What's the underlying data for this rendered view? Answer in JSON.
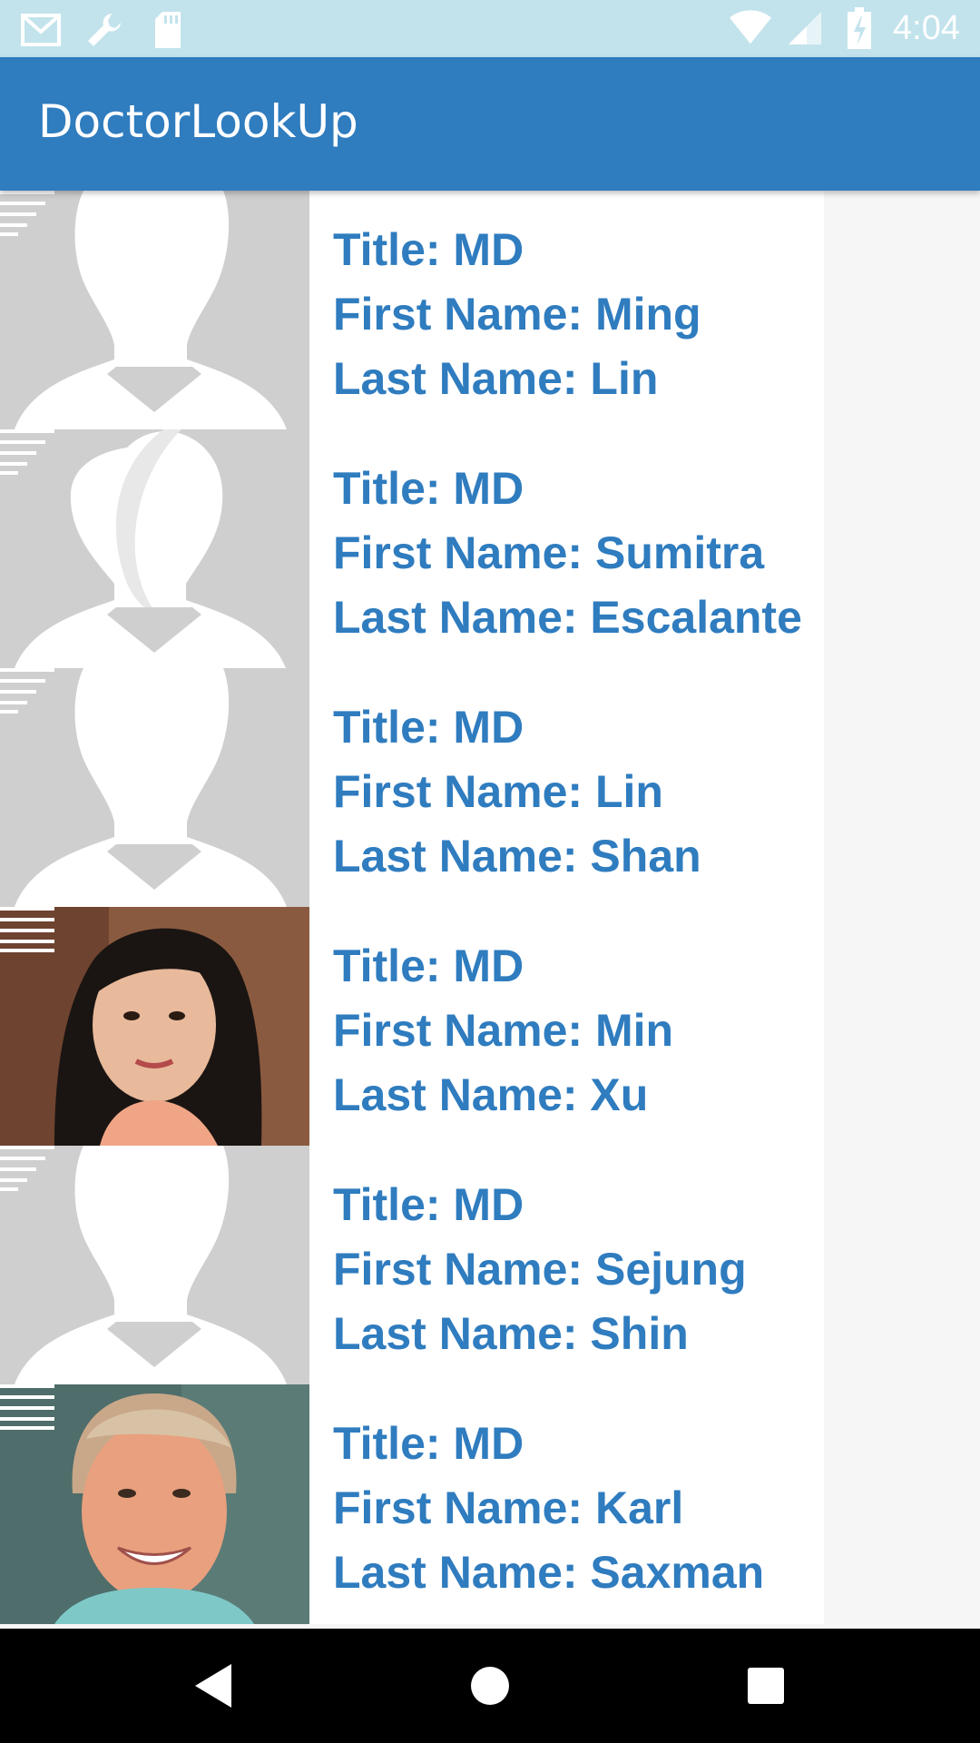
{
  "status_bar": {
    "time": "4:04",
    "icons": [
      "gmail-icon",
      "wrench-icon",
      "sd-card-icon",
      "wifi-icon",
      "signal-icon",
      "battery-charging-icon"
    ]
  },
  "app_bar": {
    "title": "DoctorLookUp"
  },
  "doctors": [
    {
      "title": "Title: MD",
      "first": "First Name: Ming",
      "last": "Last Name: Lin",
      "photo": "male-placeholder-avatar"
    },
    {
      "title": "Title: MD",
      "first": "First Name: Sumitra",
      "last": "Last Name: Escalante",
      "photo": "female-placeholder-avatar"
    },
    {
      "title": "Title: MD",
      "first": "First Name: Lin",
      "last": "Last Name: Shan",
      "photo": "male-placeholder-avatar"
    },
    {
      "title": "Title: MD",
      "first": "First Name: Min",
      "last": "Last Name: Xu",
      "photo": "portrait-photo"
    },
    {
      "title": "Title: MD",
      "first": "First Name: Sejung",
      "last": "Last Name: Shin",
      "photo": "male-placeholder-avatar"
    },
    {
      "title": "Title: MD",
      "first": "First Name: Karl",
      "last": "Last Name: Saxman",
      "photo": "portrait-photo"
    }
  ],
  "nav_bar": {
    "buttons": [
      "back-icon",
      "home-icon",
      "recents-icon"
    ]
  },
  "colors": {
    "accent": "#2f7cbf",
    "status_bar": "#c2e3ec",
    "placeholder": "#cfcfcf"
  }
}
